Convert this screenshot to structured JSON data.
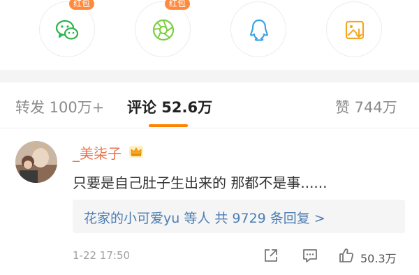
{
  "share": {
    "badge_label": "红包",
    "items": [
      {
        "icon": "wechat-icon"
      },
      {
        "icon": "moments-icon"
      },
      {
        "icon": "qq-icon"
      },
      {
        "icon": "save-image-icon"
      }
    ]
  },
  "tabs": {
    "repost": "转发 100万+",
    "comments": "评论 52.6万",
    "likes": "赞 744万",
    "active": "comments"
  },
  "comment": {
    "username": "_美柒子",
    "badge_icon": "crown-icon",
    "text": "只要是自己肚子生出来的 那都不是事......",
    "replies": "花家的小可爱yu 等人  共 9729 条回复 >",
    "time": "1-22 17:50",
    "like_count": "50.3万"
  },
  "colors": {
    "accent": "#ff8200",
    "username": "#eb7350",
    "link": "#4d7eb3",
    "badge": "#ff8a3d",
    "wechat": "#2bb24c",
    "moments": "#7bcf3e",
    "qq": "#3aa3e8",
    "save": "#f5a623"
  }
}
